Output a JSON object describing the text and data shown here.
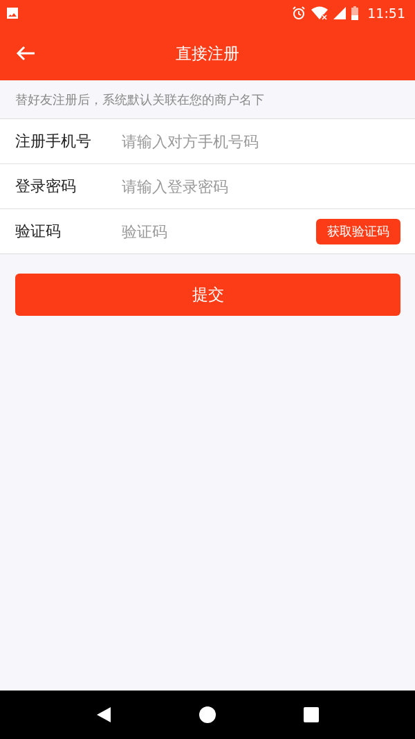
{
  "status_bar": {
    "time": "11:51"
  },
  "header": {
    "title": "直接注册"
  },
  "notice": "替好友注册后，系统默认关联在您的商户名下",
  "fields": [
    {
      "kind": "text",
      "label": "注册手机号",
      "placeholder": "请输入对方手机号码"
    },
    {
      "kind": "password",
      "label": "登录密码",
      "placeholder": "请输入登录密码"
    },
    {
      "kind": "code",
      "label": "验证码",
      "placeholder": "验证码",
      "button": "获取验证码"
    }
  ],
  "submit": "提交"
}
